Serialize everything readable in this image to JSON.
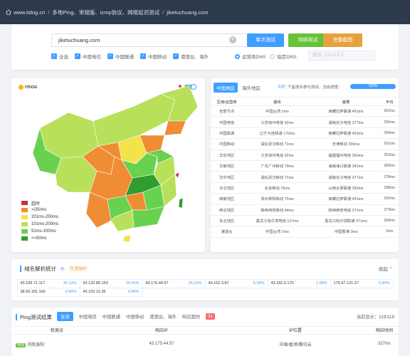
{
  "breadcrumb": {
    "site": "www.itdog.cn",
    "section": "多地Ping、常规版、icmp协议、网络延迟测试",
    "current": "jiketuchuang.com"
  },
  "search": {
    "value": "jiketuchuang.com",
    "single_btn": "单次测试",
    "continuous_btn": "持续测试",
    "full_btn": "完整截图",
    "checks": [
      "全选",
      "中国电信",
      "中国联通",
      "中国移动",
      "港澳台、海外"
    ],
    "radio_default": "运营商DNS",
    "radio_custom": "指定DNS:",
    "dns_placeholder": "例如: 223.5.5.5"
  },
  "map": {
    "logo": "ITDOG",
    "legend": [
      "超时",
      ">250ms",
      "201ms-250ms",
      "101ms-200ms",
      "51ms-100ms",
      "<=50ms"
    ],
    "legend_colors": [
      "#c23531",
      "#f08c33",
      "#f2e34a",
      "#b9e05a",
      "#69d150",
      "#2f9e2f"
    ]
  },
  "results": {
    "tab_active": "中国地区",
    "tab_other": "海外地区",
    "probe_count": "119",
    "probe_text": "个监测点参与测试，当前进度：",
    "progress": "100%",
    "progress_value": 100,
    "headers": [
      "区域/运营商",
      "最快",
      "最慢",
      "平均"
    ],
    "rows": [
      [
        "全部节点",
        "中国台湾 1ms",
        "西藏拉萨联通 401ms",
        "262ms"
      ],
      [
        "中国电信",
        "江苏徐州电信 92ms",
        "湖南长沙电信 377ms",
        "292ms"
      ],
      [
        "中国联通",
        "辽宁大连联通 170ms",
        "西藏拉萨联通 401ms",
        "294ms"
      ],
      [
        "中国移动",
        "湖北武汉移动 71ms",
        "天津移动 356ms",
        "161ms"
      ],
      [
        "华东地区",
        "江苏徐州电信 92ms",
        "福建福州电信 360ms",
        "253ms"
      ],
      [
        "华南地区",
        "广东广州移动 79ms",
        "海南海口联通 381ms",
        "300ms"
      ],
      [
        "华中地区",
        "湖北武汉移动 71ms",
        "湖南长沙电信 377ms",
        "278ms"
      ],
      [
        "华北地区",
        "北京移动 76ms",
        "山西太原联通 383ms",
        "298ms"
      ],
      [
        "西南地区",
        "贵州贵阳移动 75ms",
        "西藏拉萨联通 401ms",
        "292ms"
      ],
      [
        "西北地区",
        "陕西西安移动 94ms",
        "陕西西安电信 371ms",
        "273ms"
      ],
      [
        "东北地区",
        "黑龙江哈尔滨电信 137ms",
        "黑龙江哈尔滨联通 371ms",
        "268ms"
      ],
      [
        "港澳台",
        "中国台湾 1ms",
        "中国香港 3ms",
        "2ms"
      ]
    ]
  },
  "dns": {
    "title": "域名解析统计",
    "count": "8",
    "copy_label": "复制IP",
    "collapse": "收起",
    "ips": [
      {
        "ip": "43.159.71.117",
        "pct": "36.13%"
      },
      {
        "ip": "43.132.85.153",
        "pct": "29.41%"
      },
      {
        "ip": "43.175.44.57",
        "pct": "25.21%"
      },
      {
        "ip": "43.152.3.87",
        "pct": "5.04%"
      },
      {
        "ip": "43.152.0.170",
        "pct": "1.68%"
      },
      {
        "ip": "175.97.131.37",
        "pct": "0.84%"
      },
      {
        "ip": "38.60.181.166",
        "pct": "0.84%"
      },
      {
        "ip": "43.152.12.35",
        "pct": "0.84%"
      }
    ]
  },
  "ping": {
    "title": "Ping测试结果",
    "tabs": [
      "全部",
      "中国电信",
      "中国联通",
      "中国移动",
      "港澳台、海外",
      "响应超时"
    ],
    "timeout_count": "31",
    "current_display": "当前显示：119/119",
    "headers": [
      "检测点",
      "响应IP",
      "IP位置",
      "响应时间"
    ],
    "row": {
      "isp": "电信",
      "location": "河南洛阳",
      "ip": "43.175.44.57",
      "ip_location": "中国/香港/腾讯云",
      "time": "327ms"
    }
  }
}
